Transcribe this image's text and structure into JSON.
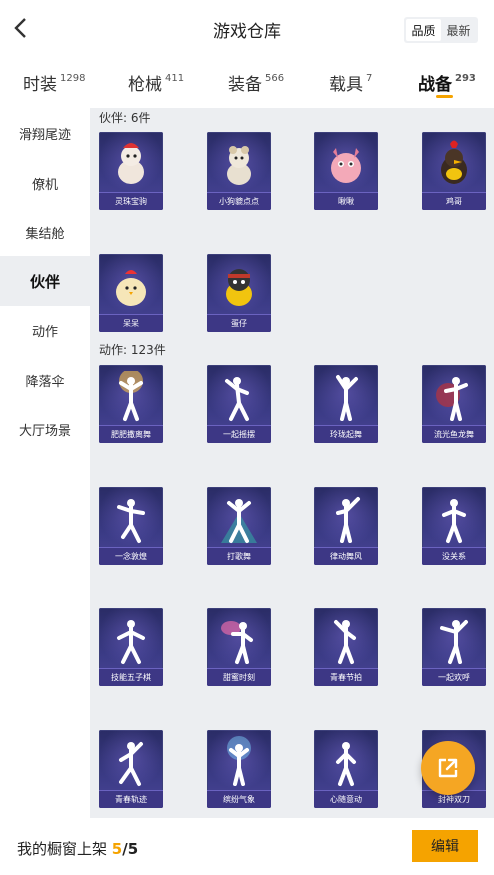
{
  "header": {
    "title": "游戏仓库",
    "sort_options": [
      "品质",
      "最新"
    ],
    "sort_active": "品质"
  },
  "categories": [
    {
      "label": "时装",
      "count": "1298"
    },
    {
      "label": "枪械",
      "count": "411"
    },
    {
      "label": "装备",
      "count": "566"
    },
    {
      "label": "载具",
      "count": "7"
    },
    {
      "label": "战备",
      "count": "293"
    }
  ],
  "active_category": "战备",
  "sidebar": {
    "items": [
      "滑翔尾迹",
      "僚机",
      "集结舱",
      "伙伴",
      "动作",
      "降落伞",
      "大厅场景"
    ],
    "active": "伙伴"
  },
  "sections": {
    "partners": {
      "label": "伙伴: 6件",
      "items": [
        "灵珠宝驹",
        "小狗貔点点",
        "啾啾",
        "鸡哥",
        "呆呆",
        "蛋仔"
      ]
    },
    "emotes": {
      "label": "动作: 123件",
      "items": [
        "肥肥撒离舞",
        "一起摇摆",
        "玲珑起舞",
        "流光鱼龙舞",
        "一念敦煌",
        "打歌舞",
        "律动舞风",
        "没关系",
        "技能五子棋",
        "甜蜜时刻",
        "青春节拍",
        "一起欢呼",
        "青春轨迹",
        "缤纷气象",
        "心随意动",
        "封神双刀"
      ]
    }
  },
  "bottom": {
    "label": "我的橱窗上架",
    "current": "5",
    "total": "/5",
    "edit_label": "编辑"
  },
  "colors": {
    "accent": "#f5a300",
    "card_bg": "#2f2f72",
    "content_bg": "#eceef1"
  }
}
